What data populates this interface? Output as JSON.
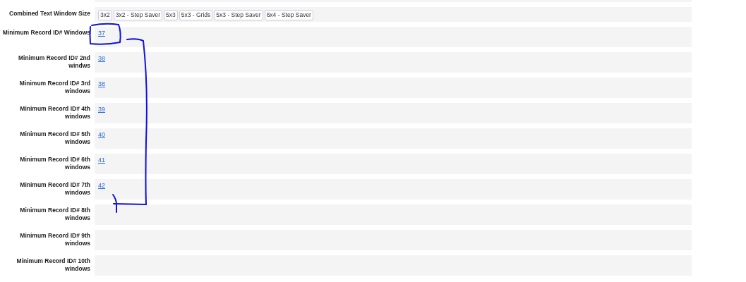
{
  "window_size": {
    "label": "Combined Text Window Size",
    "options": [
      "3x2",
      "3x2 - Step Saver",
      "5x3",
      "5x3 - Grids",
      "5x3 - Step Saver",
      "6x4 - Step Saver"
    ]
  },
  "record_rows": [
    {
      "label": "Minimum Record ID# Windows",
      "value": "37"
    },
    {
      "label": "Minimum Record ID# 2nd windws",
      "value": "38"
    },
    {
      "label": "Minimum Record ID# 3rd windows",
      "value": "38"
    },
    {
      "label": "Minimum Record ID# 4th windows",
      "value": "39"
    },
    {
      "label": "Minimum Record ID# 5th windows",
      "value": "40"
    },
    {
      "label": "Minimum Record ID# 6th windows",
      "value": "41"
    },
    {
      "label": "Minimum Record ID# 7th windows",
      "value": "42"
    },
    {
      "label": "Minimum Record ID# 8th windows"
    },
    {
      "label": "Minimum Record ID# 9th windows"
    },
    {
      "label": "Minimum Record ID# 10th windows"
    }
  ]
}
